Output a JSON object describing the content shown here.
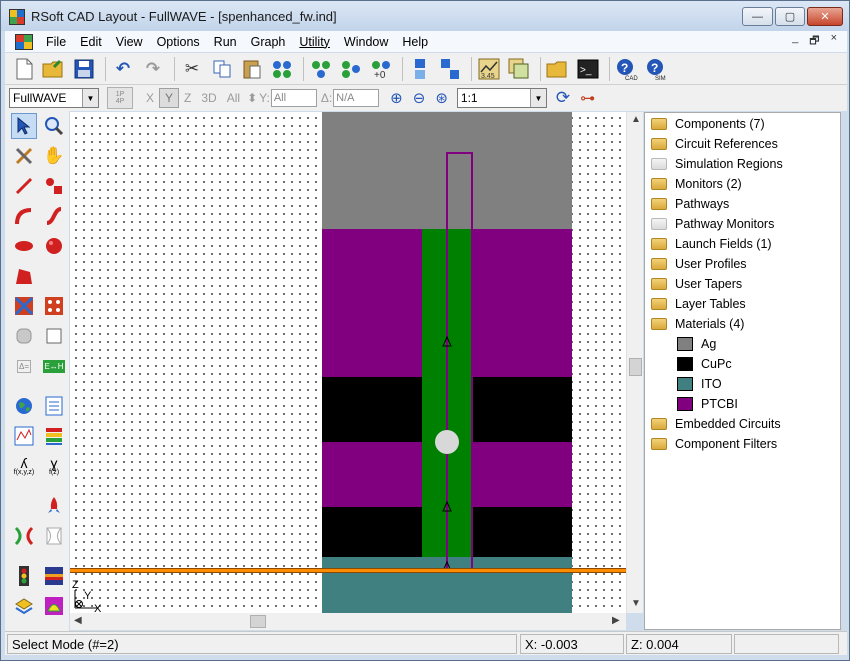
{
  "window": {
    "title": "RSoft CAD Layout - FullWAVE - [spenhanced_fw.ind]",
    "controls": {
      "minimize": "—",
      "maximize": "▢",
      "close": "✕"
    }
  },
  "menu": {
    "items": [
      "File",
      "Edit",
      "View",
      "Options",
      "Run",
      "Graph",
      "Utility",
      "Window",
      "Help"
    ],
    "mdi": {
      "minimize": "_",
      "restore": "🗗",
      "close": "×"
    }
  },
  "toolbar2": {
    "simulator": "FullWAVE",
    "btn_1p": "1P",
    "btn_4p": "4P",
    "axis_x": "X",
    "axis_y": "Y",
    "axis_z": "Z",
    "view_3d": "3D",
    "view_all": "All",
    "y_label": "Y:",
    "y_value": "All",
    "delta_label": "Δ:",
    "delta_value": "N/A",
    "zoom_ratio": "1:1"
  },
  "palette": {
    "delta_btn": "Δ=",
    "eh_btn": "E↔H",
    "f_xyz": "f(x,y,z)",
    "f_z": "f(z)"
  },
  "canvas": {
    "axis_z": "Z",
    "axis_y": "Y",
    "axis_x": "X",
    "colors": {
      "ag": "#808080",
      "cupc": "#000000",
      "ito": "#408080",
      "ptcbi": "#800080",
      "component": "#008000",
      "highlight": "#ff8c00",
      "outline": "#800080"
    }
  },
  "tree": {
    "items": [
      {
        "label": "Components (7)",
        "icon": "folder-icon"
      },
      {
        "label": "Circuit References",
        "icon": "folder-icon"
      },
      {
        "label": "Simulation Regions",
        "icon": "folder-disabled-icon"
      },
      {
        "label": "Monitors (2)",
        "icon": "folder-icon"
      },
      {
        "label": "Pathways",
        "icon": "folder-icon"
      },
      {
        "label": "Pathway Monitors",
        "icon": "folder-disabled-icon"
      },
      {
        "label": "Launch Fields (1)",
        "icon": "folder-icon"
      },
      {
        "label": "User Profiles",
        "icon": "folder-icon"
      },
      {
        "label": "User Tapers",
        "icon": "folder-icon"
      },
      {
        "label": "Layer Tables",
        "icon": "folder-icon"
      },
      {
        "label": "Materials (4)",
        "icon": "folder-open-icon"
      }
    ],
    "materials": [
      {
        "label": "Ag",
        "color": "#808080"
      },
      {
        "label": "CuPc",
        "color": "#000000"
      },
      {
        "label": "ITO",
        "color": "#408080"
      },
      {
        "label": "PTCBI",
        "color": "#800080"
      }
    ],
    "items_after": [
      {
        "label": "Embedded Circuits",
        "icon": "folder-icon"
      },
      {
        "label": "Component Filters",
        "icon": "folder-icon"
      }
    ]
  },
  "status": {
    "mode": "Select Mode (#=2)",
    "x": "X: -0.003",
    "z": "Z: 0.004",
    "extra": ""
  }
}
